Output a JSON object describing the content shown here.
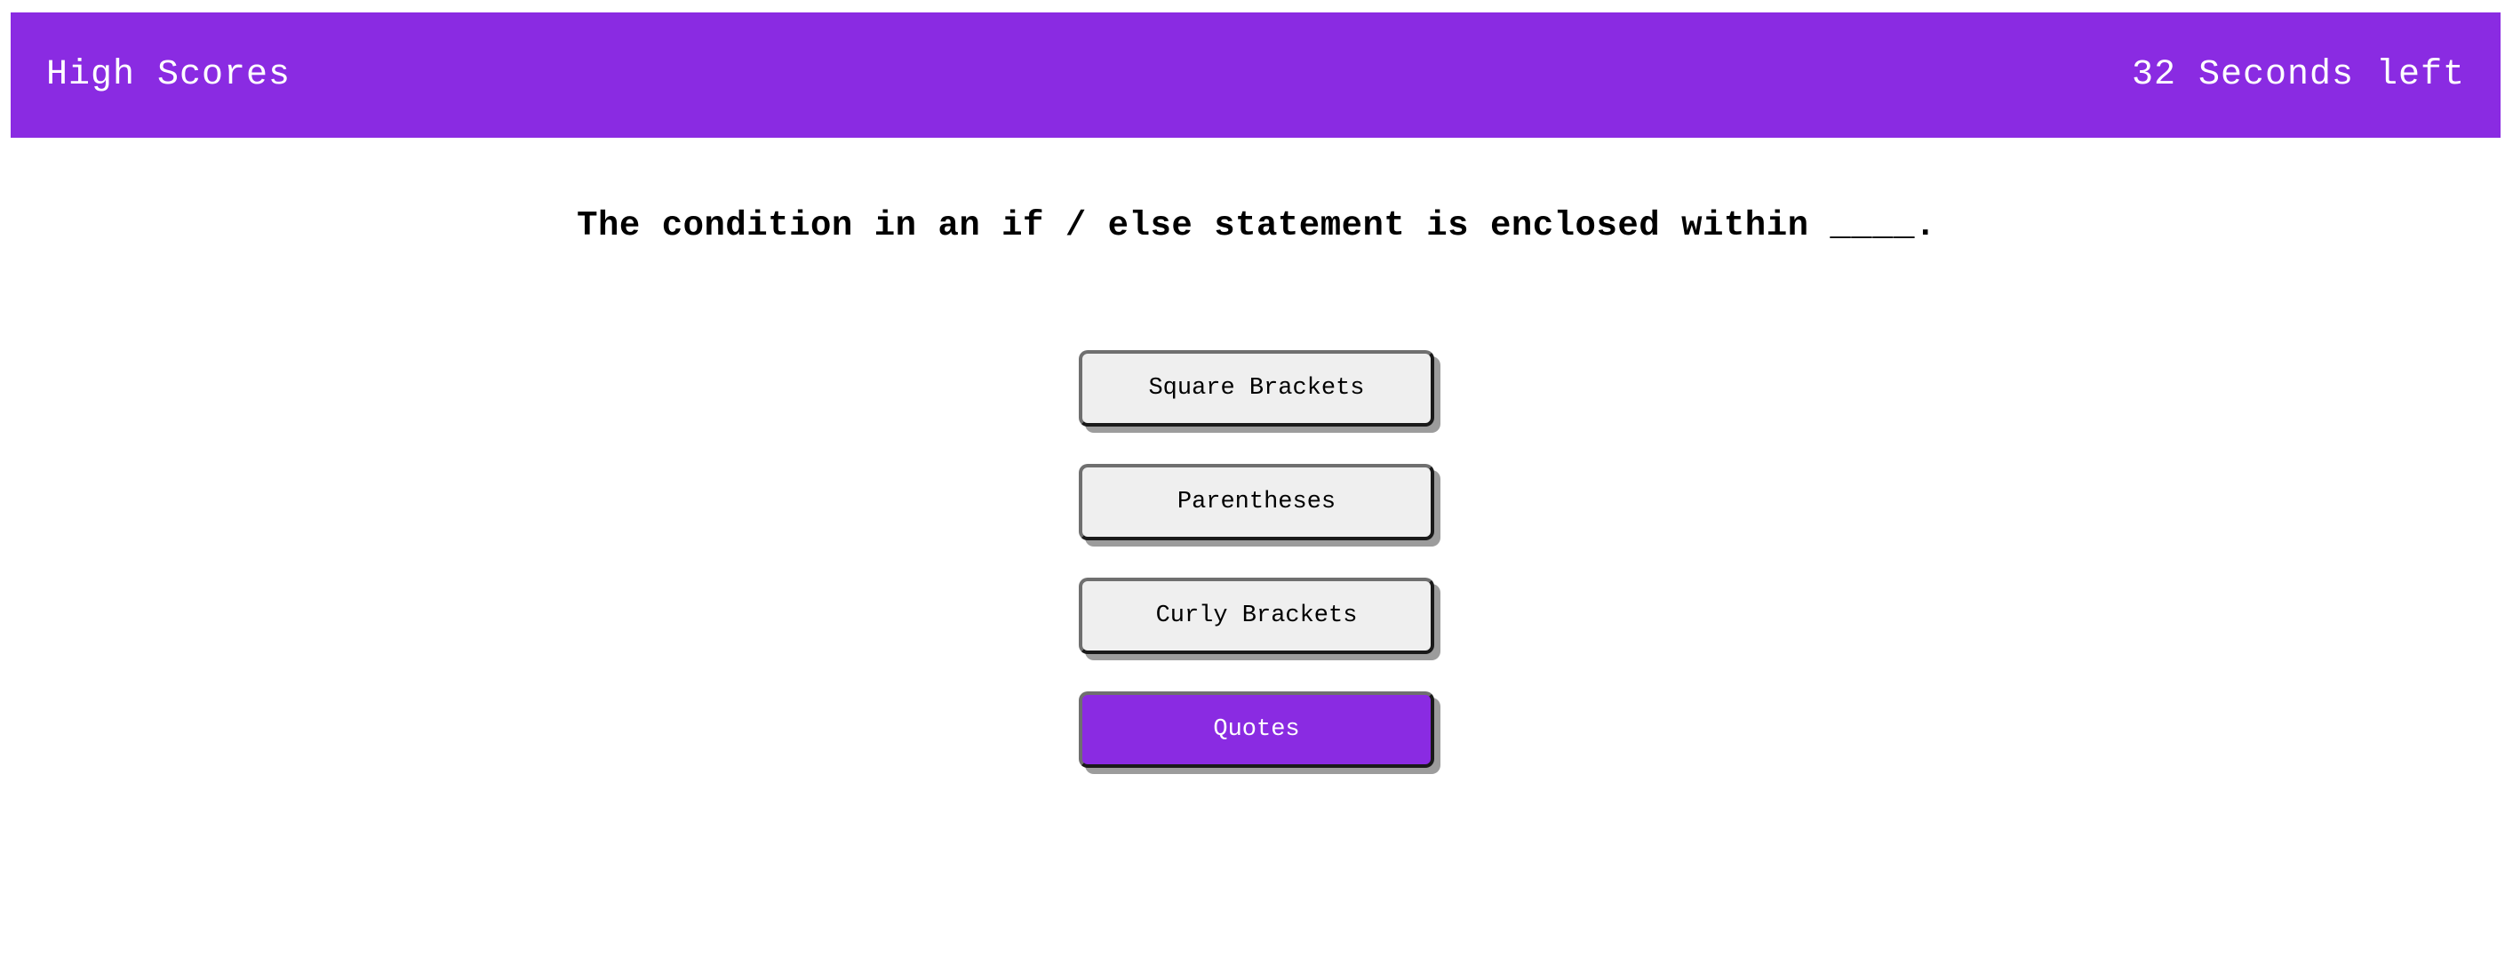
{
  "header": {
    "high_scores_label": "High Scores",
    "timer_text": "32 Seconds left",
    "background_color": "#8a2be2"
  },
  "question": {
    "text": "The condition in an if / else statement is enclosed within ____."
  },
  "answers": [
    {
      "label": "Square Brackets",
      "selected": false
    },
    {
      "label": "Parentheses",
      "selected": false
    },
    {
      "label": "Curly Brackets",
      "selected": false
    },
    {
      "label": "Quotes",
      "selected": true
    }
  ],
  "colors": {
    "accent": "#8a2be2",
    "button_background": "#efefef",
    "button_shadow": "#9c9c9c"
  }
}
